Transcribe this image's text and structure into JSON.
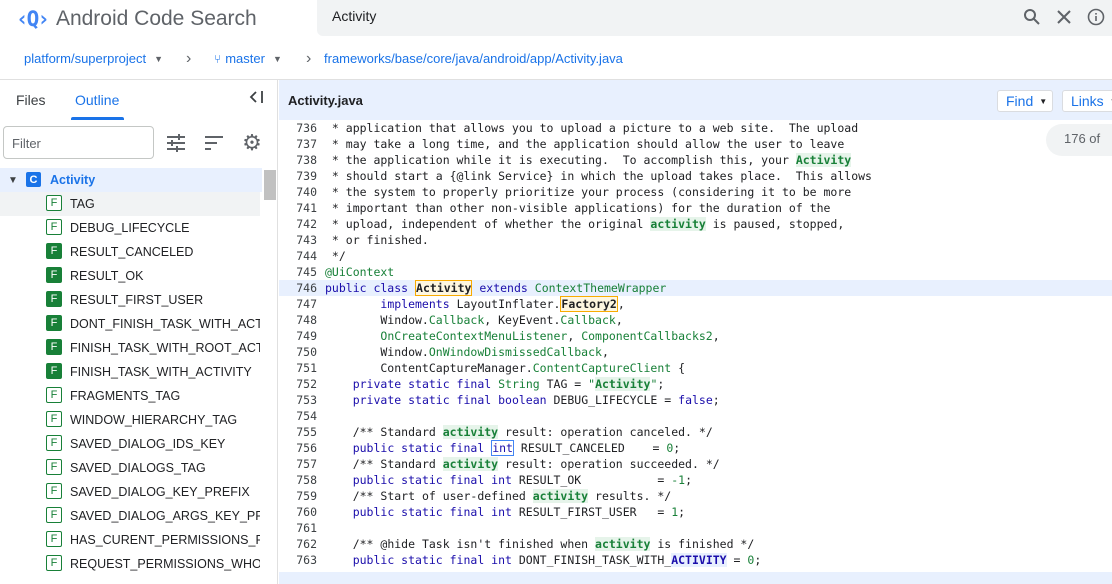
{
  "app": {
    "title": "Android Code Search",
    "logo": "‹Q›"
  },
  "search": {
    "value": "Activity"
  },
  "breadcrumb": {
    "project": "platform/superproject",
    "branch": "master",
    "path": "frameworks/base/core/java/android/app/Activity.java"
  },
  "left_panel": {
    "tabs": {
      "files": "Files",
      "outline": "Outline"
    },
    "filter_placeholder": "Filter",
    "root": {
      "kind": "C",
      "label": "Activity"
    },
    "items": [
      {
        "kind": "F",
        "filled": false,
        "label": "TAG"
      },
      {
        "kind": "F",
        "filled": false,
        "label": "DEBUG_LIFECYCLE"
      },
      {
        "kind": "F",
        "filled": true,
        "label": "RESULT_CANCELED"
      },
      {
        "kind": "F",
        "filled": true,
        "label": "RESULT_OK"
      },
      {
        "kind": "F",
        "filled": true,
        "label": "RESULT_FIRST_USER"
      },
      {
        "kind": "F",
        "filled": true,
        "label": "DONT_FINISH_TASK_WITH_ACTI"
      },
      {
        "kind": "F",
        "filled": true,
        "label": "FINISH_TASK_WITH_ROOT_ACTI"
      },
      {
        "kind": "F",
        "filled": true,
        "label": "FINISH_TASK_WITH_ACTIVITY"
      },
      {
        "kind": "F",
        "filled": false,
        "label": "FRAGMENTS_TAG"
      },
      {
        "kind": "F",
        "filled": false,
        "label": "WINDOW_HIERARCHY_TAG"
      },
      {
        "kind": "F",
        "filled": false,
        "label": "SAVED_DIALOG_IDS_KEY"
      },
      {
        "kind": "F",
        "filled": false,
        "label": "SAVED_DIALOGS_TAG"
      },
      {
        "kind": "F",
        "filled": false,
        "label": "SAVED_DIALOG_KEY_PREFIX"
      },
      {
        "kind": "F",
        "filled": false,
        "label": "SAVED_DIALOG_ARGS_KEY_PRE"
      },
      {
        "kind": "F",
        "filled": false,
        "label": "HAS_CURENT_PERMISSIONS_RE"
      },
      {
        "kind": "F",
        "filled": false,
        "label": "REQUEST_PERMISSIONS_WHO_"
      }
    ]
  },
  "file": {
    "name": "Activity.java",
    "find_label": "Find",
    "links_label": "Links",
    "match_count": "176 of"
  },
  "code_lines": [
    {
      "n": "736",
      "html": "<span class=\"cm\"> * application that allows you to upload a picture to a web site.  The upload</span>"
    },
    {
      "n": "737",
      "html": "<span class=\"cm\"> * may take a long time, and the application should allow the user to leave</span>"
    },
    {
      "n": "738",
      "html": "<span class=\"cm\"> * the application while it is executing.  To accomplish this, your <span class=\"hl\">Activity</span></span>"
    },
    {
      "n": "739",
      "html": "<span class=\"cm\"> * should start a {@link Service} in which the upload takes place.  This allows</span>"
    },
    {
      "n": "740",
      "html": "<span class=\"cm\"> * the system to properly prioritize your process (considering it to be more</span>"
    },
    {
      "n": "741",
      "html": "<span class=\"cm\"> * important than other non-visible applications) for the duration of the</span>"
    },
    {
      "n": "742",
      "html": "<span class=\"cm\"> * upload, independent of whether the original <span class=\"hl\">activity</span> is paused, stopped,</span>"
    },
    {
      "n": "743",
      "html": "<span class=\"cm\"> * or finished.</span>"
    },
    {
      "n": "744",
      "html": "<span class=\"cm\"> */</span>"
    },
    {
      "n": "745",
      "html": "<span class=\"an\">@UiContext</span>"
    },
    {
      "n": "746",
      "cur": true,
      "html": "<span class=\"kw\">public class</span> <span class=\"hly\">Activity</span> <span class=\"kw\">extends</span> <span class=\"ty\">ContextThemeWrapper</span>"
    },
    {
      "n": "747",
      "html": "        <span class=\"kw\">implements</span> LayoutInflater.<span class=\"hly\">Factory2</span>,"
    },
    {
      "n": "748",
      "html": "        Window.<span class=\"ty\">Callback</span>, KeyEvent.<span class=\"ty\">Callback</span>,"
    },
    {
      "n": "749",
      "html": "        <span class=\"ty\">OnCreateContextMenuListener</span>, <span class=\"ty\">ComponentCallbacks2</span>,"
    },
    {
      "n": "750",
      "html": "        Window.<span class=\"ty\">OnWindowDismissedCallback</span>,"
    },
    {
      "n": "751",
      "html": "        ContentCaptureManager.<span class=\"ty\">ContentCaptureClient</span> {"
    },
    {
      "n": "752",
      "html": "    <span class=\"kw\">private static final</span> <span class=\"ty\">String</span> TAG = <span class=\"st\">\"<span class=\"hl\">Activity</span>\"</span>;"
    },
    {
      "n": "753",
      "html": "    <span class=\"kw\">private static final boolean</span> DEBUG_LIFECYCLE = <span class=\"kw\">false</span>;"
    },
    {
      "n": "754",
      "html": ""
    },
    {
      "n": "755",
      "html": "    <span class=\"cm\">/** Standard <span class=\"hl\">activity</span> result: operation canceled. */</span>"
    },
    {
      "n": "756",
      "html": "    <span class=\"kw\">public static final</span> <span class=\"kw hlbox\">int</span> RESULT_CANCELED    = <span class=\"st\">0</span>;"
    },
    {
      "n": "757",
      "html": "    <span class=\"cm\">/** Standard <span class=\"hl\">activity</span> result: operation succeeded. */</span>"
    },
    {
      "n": "758",
      "html": "    <span class=\"kw\">public static final int</span> RESULT_OK           = <span class=\"st\">-1</span>;"
    },
    {
      "n": "759",
      "html": "    <span class=\"cm\">/** Start of user-defined <span class=\"hl\">activity</span> results. */</span>"
    },
    {
      "n": "760",
      "html": "    <span class=\"kw\">public static final int</span> RESULT_FIRST_USER   = <span class=\"st\">1</span>;"
    },
    {
      "n": "761",
      "html": ""
    },
    {
      "n": "762",
      "html": "    <span class=\"cm\">/** @hide Task isn't finished when <span class=\"hl\">activity</span> is finished */</span>"
    },
    {
      "n": "763",
      "html": "    <span class=\"kw\">public static final int</span> DONT_FINISH_TASK_WITH_<span class=\"hlb\">ACTIVITY</span> = <span class=\"st\">0</span>;"
    }
  ]
}
